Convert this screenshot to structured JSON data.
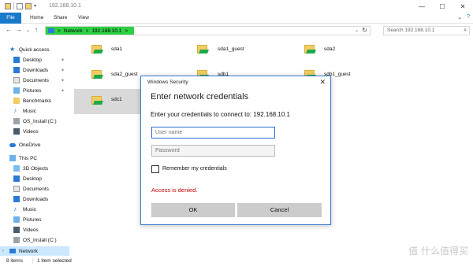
{
  "window": {
    "title": "192.168.10.1"
  },
  "ribbon": {
    "tabs": [
      "File",
      "Home",
      "Share",
      "View"
    ]
  },
  "address": {
    "root": "Network",
    "host": "192.168.10.1",
    "separator": ">"
  },
  "search": {
    "placeholder": "Search 192.168.10.1"
  },
  "nav": {
    "quick_access": "Quick access",
    "quick_items": [
      "Desktop",
      "Downloads",
      "Documents",
      "Pictures",
      "Benchmarks",
      "Music",
      "OS_Install (C:)",
      "Videos"
    ],
    "onedrive": "OneDrive",
    "this_pc": "This PC",
    "pc_items": [
      "3D Objects",
      "Desktop",
      "Documents",
      "Downloads",
      "Music",
      "Pictures",
      "Videos",
      "OS_Install (C:)"
    ],
    "network": "Network"
  },
  "folders": [
    "sda1",
    "sda1_guest",
    "sda2",
    "sda2_guest",
    "sdb1",
    "sdb1_guest",
    "sdc1"
  ],
  "status": {
    "items": "8 items",
    "selected": "1 item selected"
  },
  "watermark": "值 什么值得买",
  "dialog": {
    "title": "Windows Security",
    "heading": "Enter network credentials",
    "prompt": "Enter your credentials to connect to: 192.168.10.1",
    "username_placeholder": "User name",
    "password_placeholder": "Password",
    "remember": "Remember my credentials",
    "error": "Access is denied.",
    "ok": "OK",
    "cancel": "Cancel"
  },
  "colors": {
    "accent": "#1979ca",
    "address_highlight": "#2ed043",
    "error": "#c40000",
    "folder": "#f1cd62",
    "share_overlay": "#1fa84a"
  }
}
